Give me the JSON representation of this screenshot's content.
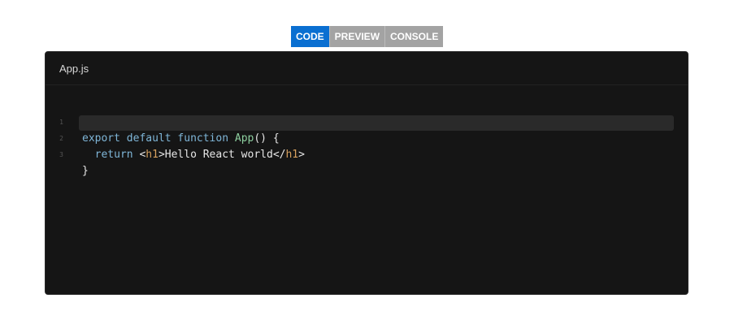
{
  "tabs": [
    {
      "label": "CODE",
      "active": true
    },
    {
      "label": "PREVIEW",
      "active": false
    },
    {
      "label": "CONSOLE",
      "active": false
    }
  ],
  "file": {
    "name": "App.js"
  },
  "code": {
    "lines": [
      {
        "number": "1",
        "tokens": [
          "export",
          "default",
          "function",
          "App",
          "() {"
        ]
      },
      {
        "number": "2",
        "tokens": [
          "return",
          "<",
          "h1",
          ">Hello React world</",
          "h1",
          ">"
        ]
      },
      {
        "number": "3",
        "tokens": [
          "}"
        ]
      }
    ]
  },
  "colors": {
    "active_tab": "#0a6fd1",
    "inactive_tab": "#a3a3a3",
    "editor_bg": "#151515",
    "keyword": "#7fb6d8",
    "function_name": "#8dcf9f",
    "tag": "#d7a15e"
  }
}
